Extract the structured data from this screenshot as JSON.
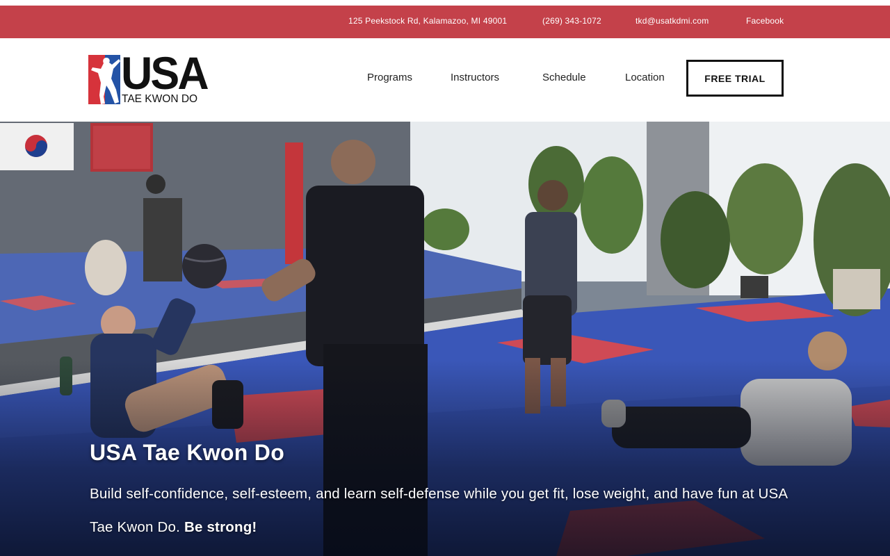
{
  "topbar": {
    "address": "125 Peekstock Rd, Kalamazoo, MI 49001",
    "phone": "(269) 343-1072",
    "email": "tkd@usatkdmi.com",
    "facebook": "Facebook"
  },
  "logo": {
    "title": "USA",
    "subtitle": "TAE KWON DO"
  },
  "nav": {
    "programs": "Programs",
    "instructors": "Instructors",
    "schedule": "Schedule",
    "location": "Location",
    "free_trial": "FREE TRIAL"
  },
  "hero": {
    "title": "USA Tae Kwon Do",
    "text": "Build self-confidence, self-esteem, and learn self-defense while you get fit, lose weight, and have fun at USA Tae Kwon Do.",
    "emphasis": "Be strong!"
  },
  "colors": {
    "topbar_bg": "#c4414a",
    "logo_red": "#d6333b",
    "logo_blue": "#2453a6",
    "mat_blue": "#3a57b8",
    "mat_red": "#cf4a55"
  }
}
